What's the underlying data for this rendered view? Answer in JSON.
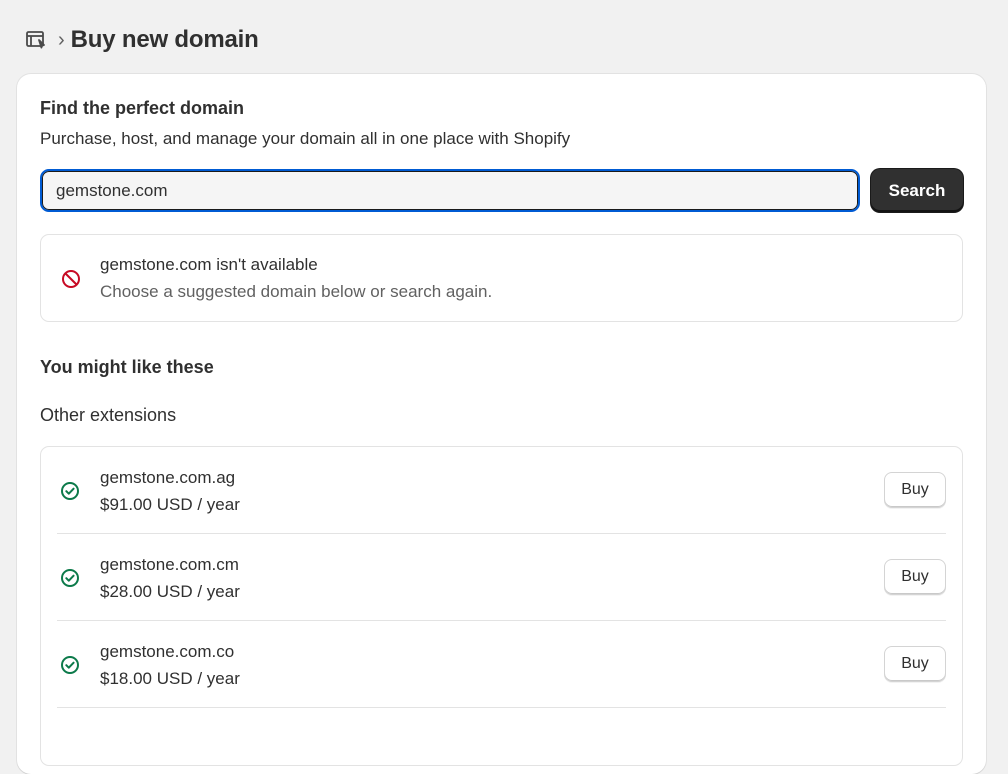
{
  "header": {
    "icon": "domains-icon",
    "separator": "›",
    "title": "Buy new domain"
  },
  "card": {
    "title": "Find the perfect domain",
    "subtitle": "Purchase, host, and manage your domain all in one place with Shopify",
    "search": {
      "value": "gemstone.com",
      "button_label": "Search"
    },
    "banner": {
      "icon": "blocked-icon",
      "title": "gemstone.com isn't available",
      "message": "Choose a suggested domain below or search again."
    },
    "suggestions_heading": "You might like these",
    "extensions_heading": "Other extensions",
    "domains": [
      {
        "name": "gemstone.com.ag",
        "price": "$91.00 USD / year",
        "button": "Buy"
      },
      {
        "name": "gemstone.com.cm",
        "price": "$28.00 USD / year",
        "button": "Buy"
      },
      {
        "name": "gemstone.com.co",
        "price": "$18.00 USD / year",
        "button": "Buy"
      }
    ]
  },
  "colors": {
    "accent_focus": "#005bd3",
    "primary_button": "#303030",
    "success": "#0c7a4a",
    "critical": "#c70a24"
  }
}
